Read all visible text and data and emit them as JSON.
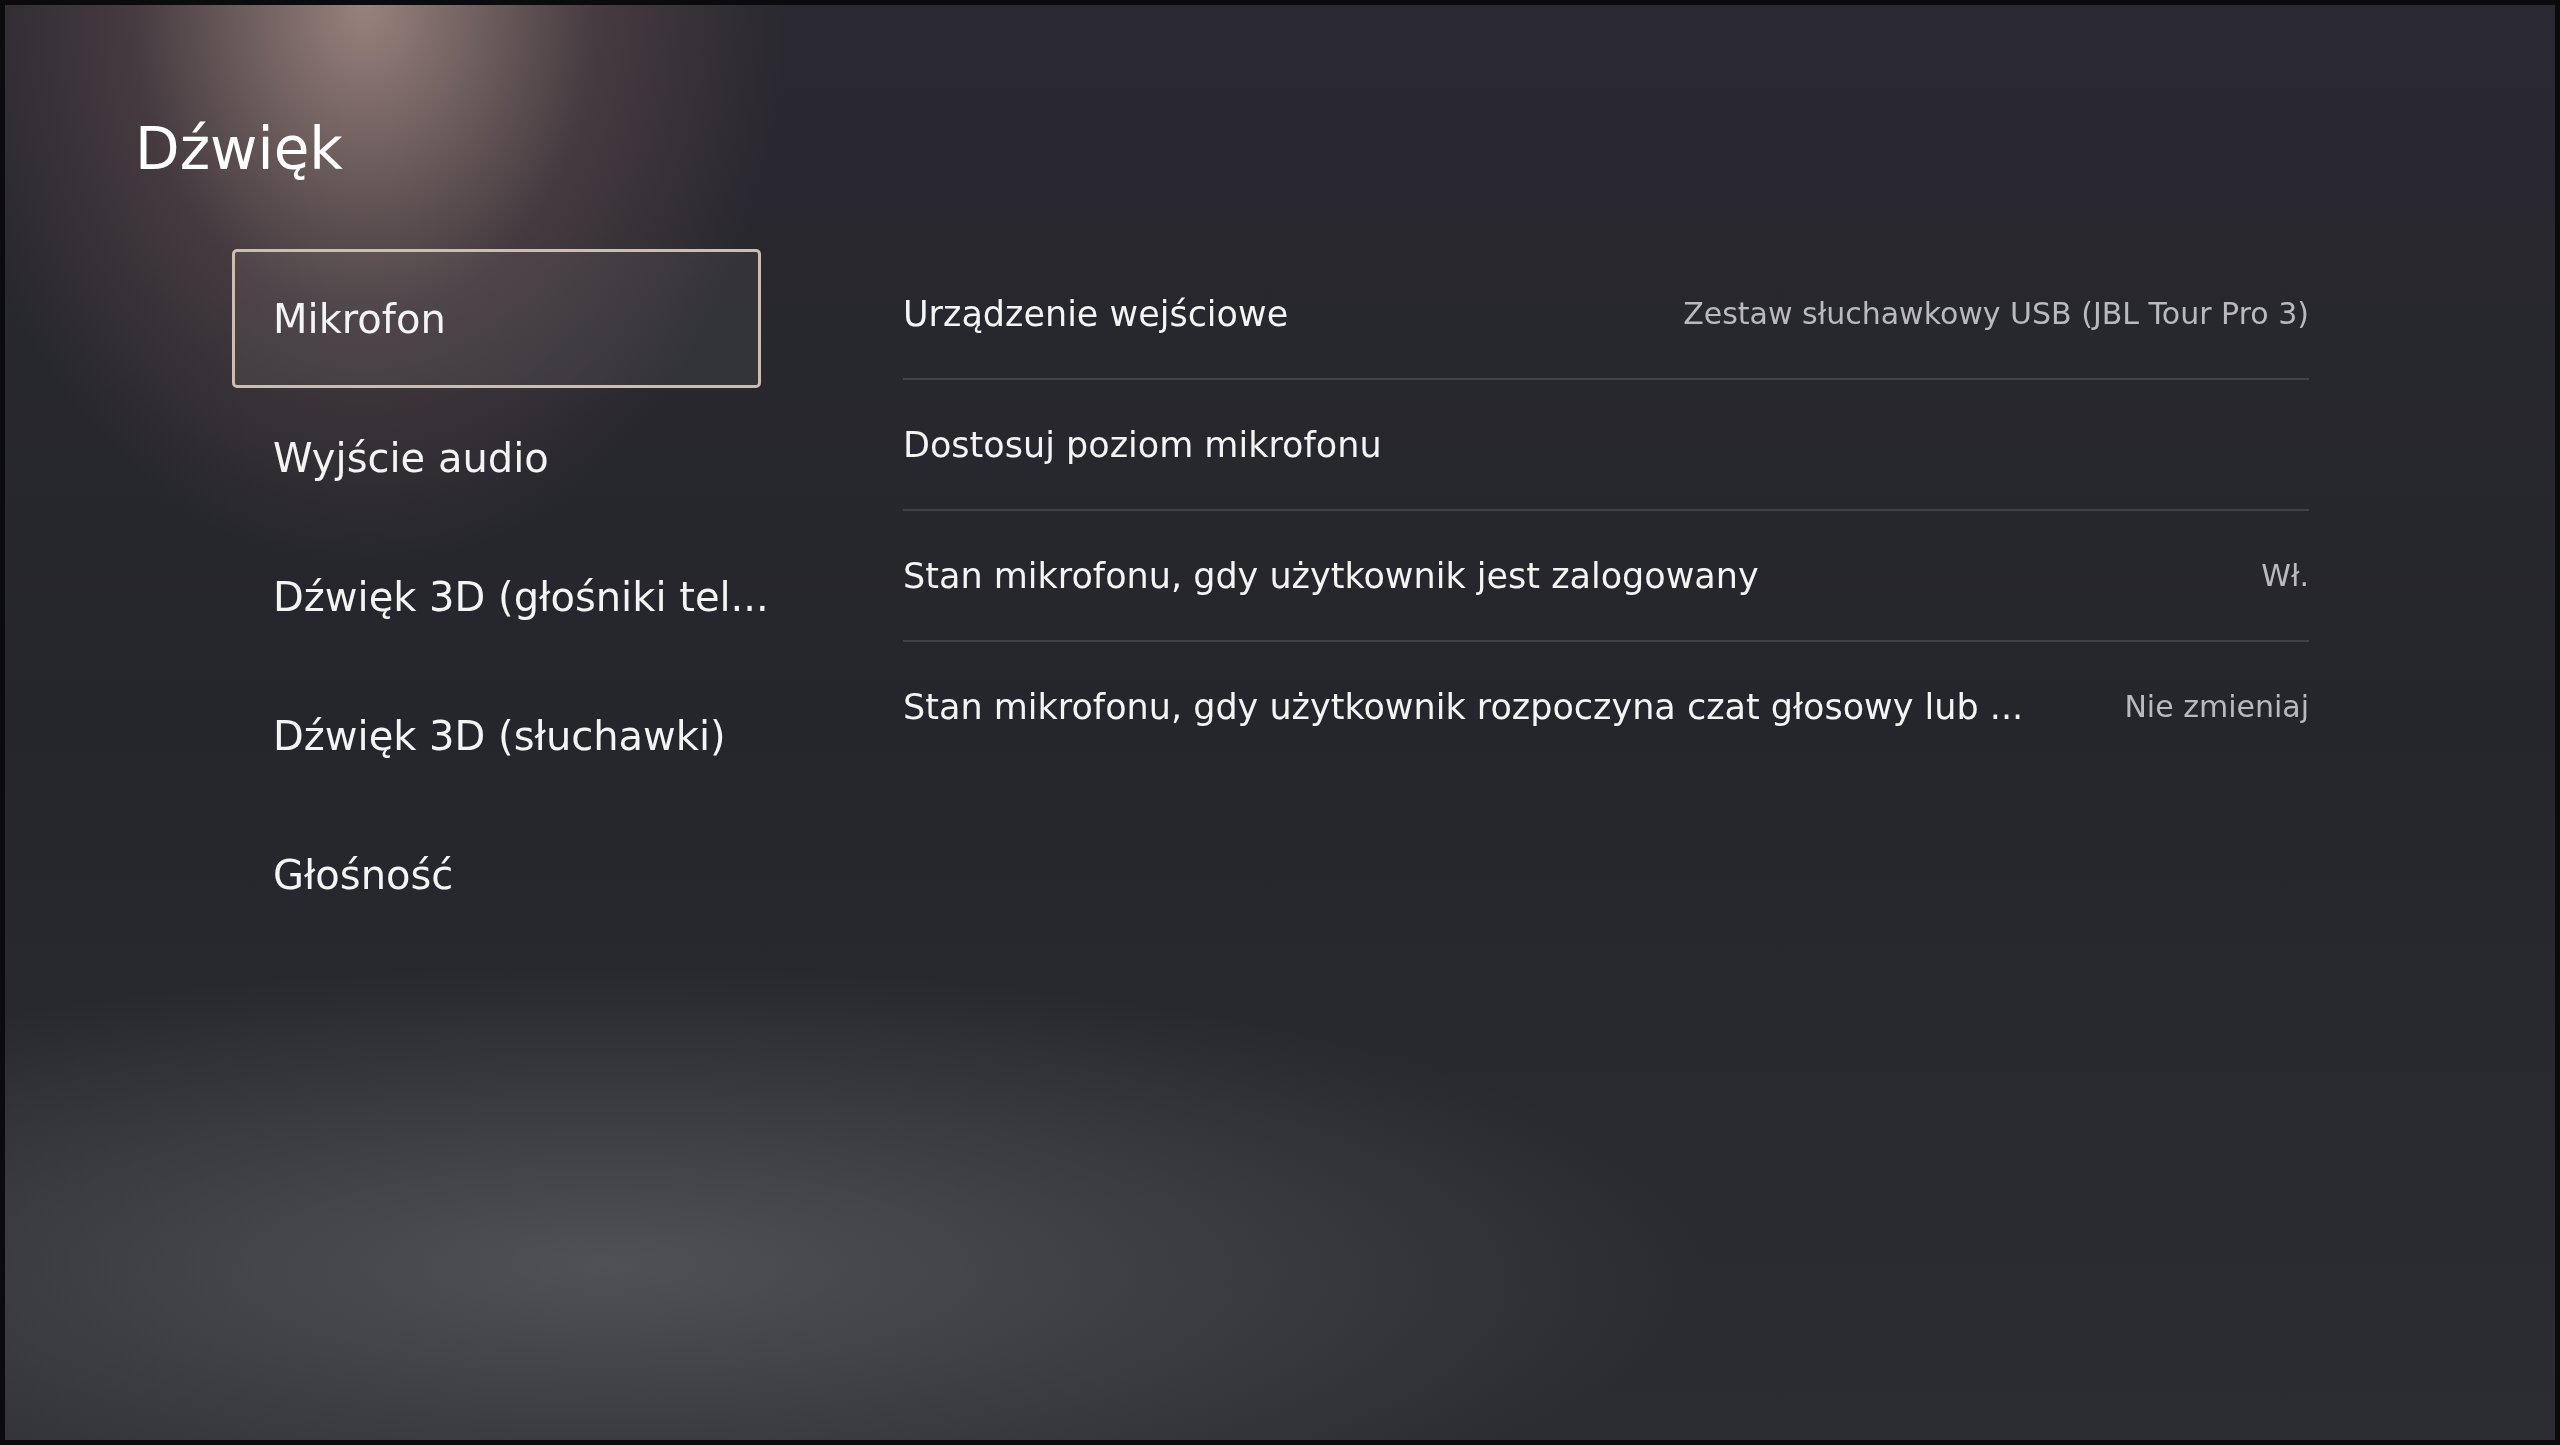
{
  "title": "Dźwięk",
  "menu": [
    {
      "label": "Mikrofon",
      "selected": true
    },
    {
      "label": "Wyjście audio",
      "selected": false
    },
    {
      "label": "Dźwięk 3D (głośniki tel...",
      "selected": false
    },
    {
      "label": "Dźwięk 3D (słuchawki)",
      "selected": false
    },
    {
      "label": "Głośność",
      "selected": false
    }
  ],
  "settings": [
    {
      "label": "Urządzenie wejściowe",
      "value": "Zestaw słuchawkowy USB (JBL Tour Pro 3)"
    },
    {
      "label": "Dostosuj poziom mikrofonu"
    },
    {
      "label": "Stan mikrofonu, gdy użytkownik jest zalogowany",
      "value": "Wł."
    },
    {
      "label": "Stan mikrofonu, gdy użytkownik rozpoczyna czat głosowy lub ...",
      "value": "Nie zmieniaj"
    }
  ]
}
